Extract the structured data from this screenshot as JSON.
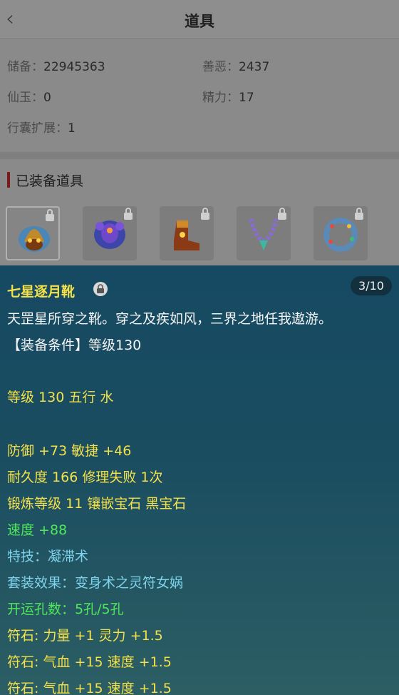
{
  "header": {
    "title": "道具"
  },
  "stats": {
    "storage_label": "储备：",
    "storage_value": "22945363",
    "karma_label": "善恶：",
    "karma_value": "2437",
    "jade_label": "仙玉：",
    "jade_value": "0",
    "energy_label": "精力：",
    "energy_value": "17",
    "bag_label": "行囊扩展：",
    "bag_value": "1"
  },
  "equipped": {
    "title": "已装备道具",
    "slots": [
      {
        "name": "helmet"
      },
      {
        "name": "armor"
      },
      {
        "name": "boots"
      },
      {
        "name": "necklace"
      },
      {
        "name": "ring"
      }
    ]
  },
  "detail": {
    "name": "七星逐月靴",
    "pager": "3/10",
    "desc": "天罡星所穿之靴。穿之及疾如风，三界之地任我遨游。",
    "req": "【装备条件】等级130",
    "level_line": "等级 130 五行 水",
    "attr1": "防御 +73 敏捷 +46",
    "attr2": "耐久度 166 修理失败 1次",
    "attr3": "锻炼等级 11 镶嵌宝石 黑宝石",
    "speed": "速度 +88",
    "skill": "特技：凝滞术",
    "set": "套装效果：变身术之灵符女娲",
    "holes": "开运孔数：5孔/5孔",
    "rune1": "符石: 力量 +1 灵力 +1.5",
    "rune2": "符石: 气血 +15 速度 +1.5",
    "rune3": "符石: 气血 +15 速度 +1.5"
  },
  "colors": {
    "name": "#f4e14a",
    "green": "#4fe85a",
    "lightblue": "#7fd3ea"
  }
}
